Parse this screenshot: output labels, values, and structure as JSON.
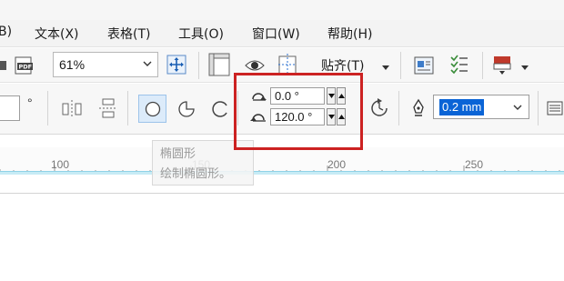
{
  "menu": {
    "items": [
      {
        "label": "B)"
      },
      {
        "label": "文本(X)"
      },
      {
        "label": "表格(T)"
      },
      {
        "label": "工具(O)"
      },
      {
        "label": "窗口(W)"
      },
      {
        "label": "帮助(H)"
      }
    ]
  },
  "toolbar": {
    "zoom_value": "61%",
    "snap_label": "贴齐(T)",
    "pdf_icon_text": "PDF"
  },
  "property_bar": {
    "degree_symbol": "°",
    "start_angle": "0.0 °",
    "end_angle": "120.0 °",
    "outline_width": "0.2 mm"
  },
  "ruler": {
    "labels": [
      "100",
      "150",
      "200",
      "250"
    ]
  },
  "tooltip": {
    "title": "椭圆形",
    "description": "绘制椭圆形。"
  },
  "colors": {
    "highlight_border": "#cc2222",
    "selection_blue": "#0a64d6",
    "active_button_bg": "#dcebfa",
    "ruler_accent": "#8fd3e8"
  },
  "icons": [
    "pdf-icon",
    "zoom-dropdown-icon",
    "full-screen-icon",
    "rulers-icon",
    "show-icon",
    "guidelines-icon",
    "snap-dropdown-icon",
    "welcome-screen-icon",
    "options-icon",
    "launcher-icon",
    "mirror-horizontal-icon",
    "mirror-vertical-icon",
    "ellipse-icon",
    "pie-icon",
    "arc-icon",
    "start-angle-icon",
    "end-angle-icon",
    "direction-icon",
    "outline-pen-icon",
    "wrap-icon"
  ]
}
